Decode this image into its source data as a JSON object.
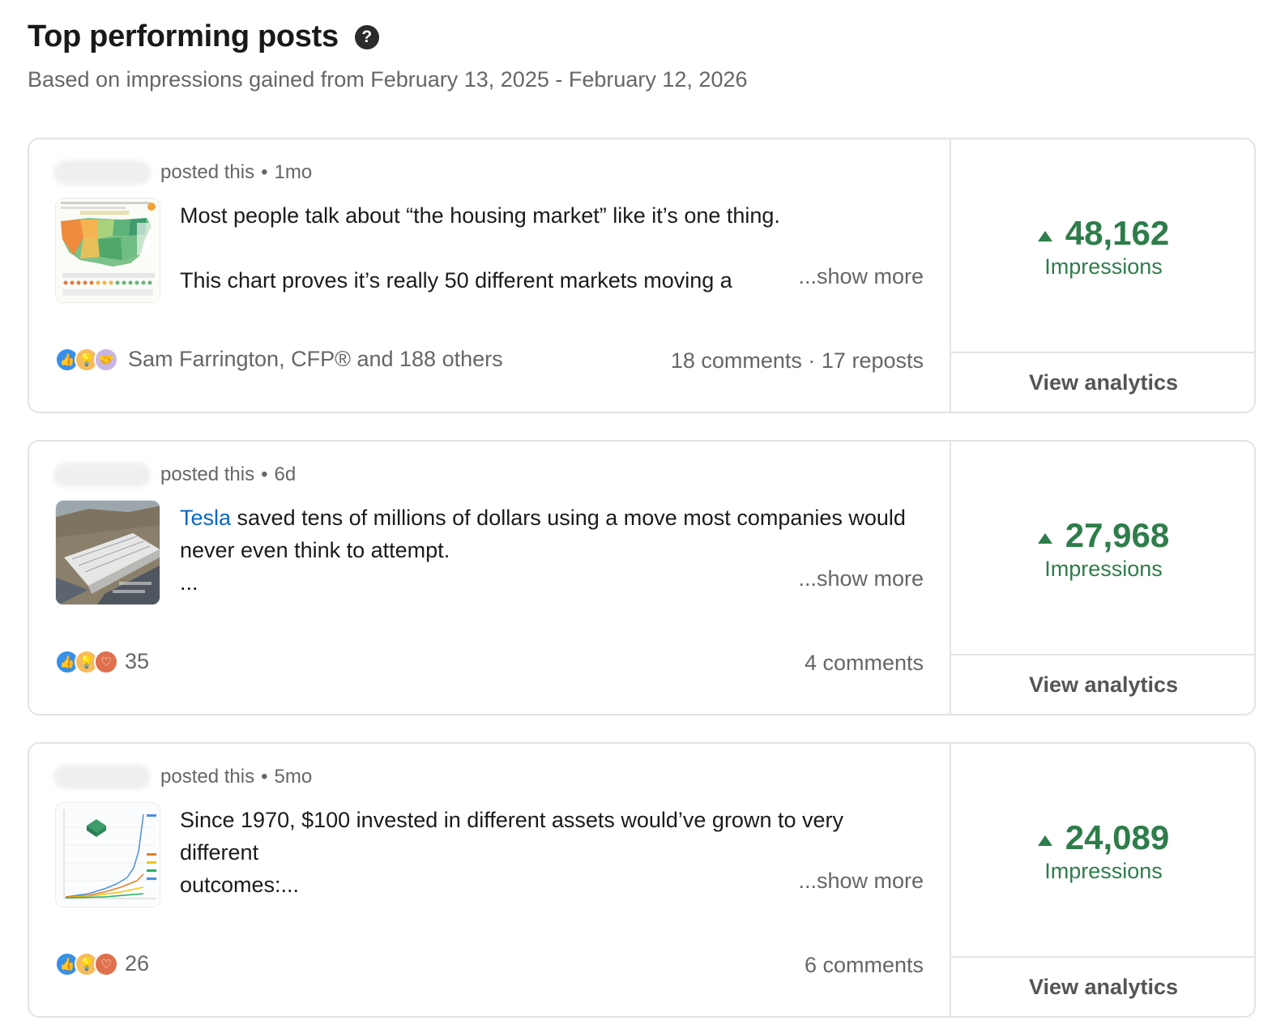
{
  "header": {
    "title": "Top performing posts",
    "help_icon": "?",
    "subtitle": "Based on impressions gained from February 13, 2025 - February 12, 2026"
  },
  "posts": [
    {
      "posted_label": "posted this",
      "time": "1mo",
      "text_line1": "Most people talk about “the housing market” like it’s one thing.",
      "text_line2": "This chart proves it’s really 50 different markets moving a",
      "show_more": "...show more",
      "reaction_text": "Sam Farrington, CFP® and 188 others",
      "engagement": "18 comments · 17 reposts",
      "impressions": "48,162",
      "impressions_label": "Impressions",
      "view_analytics": "View analytics"
    },
    {
      "posted_label": "posted this",
      "time": "6d",
      "text_link": "Tesla",
      "text_rest": " saved tens of millions of dollars using a move most companies would never even think to attempt.",
      "text_line3": "...",
      "show_more": "...show more",
      "reaction_text": "35",
      "engagement": "4 comments",
      "impressions": "27,968",
      "impressions_label": "Impressions",
      "view_analytics": "View analytics"
    },
    {
      "posted_label": "posted this",
      "time": "5mo",
      "text_line1": "Since 1970, $100 invested in different assets would’ve grown to very different",
      "text_line3": "outcomes:...",
      "show_more": "...show more",
      "reaction_text": "26",
      "engagement": "6 comments",
      "impressions": "24,089",
      "impressions_label": "Impressions",
      "view_analytics": "View analytics"
    }
  ],
  "colors": {
    "impressions_green": "#2e7d4a",
    "link_blue": "#0a66c2"
  }
}
